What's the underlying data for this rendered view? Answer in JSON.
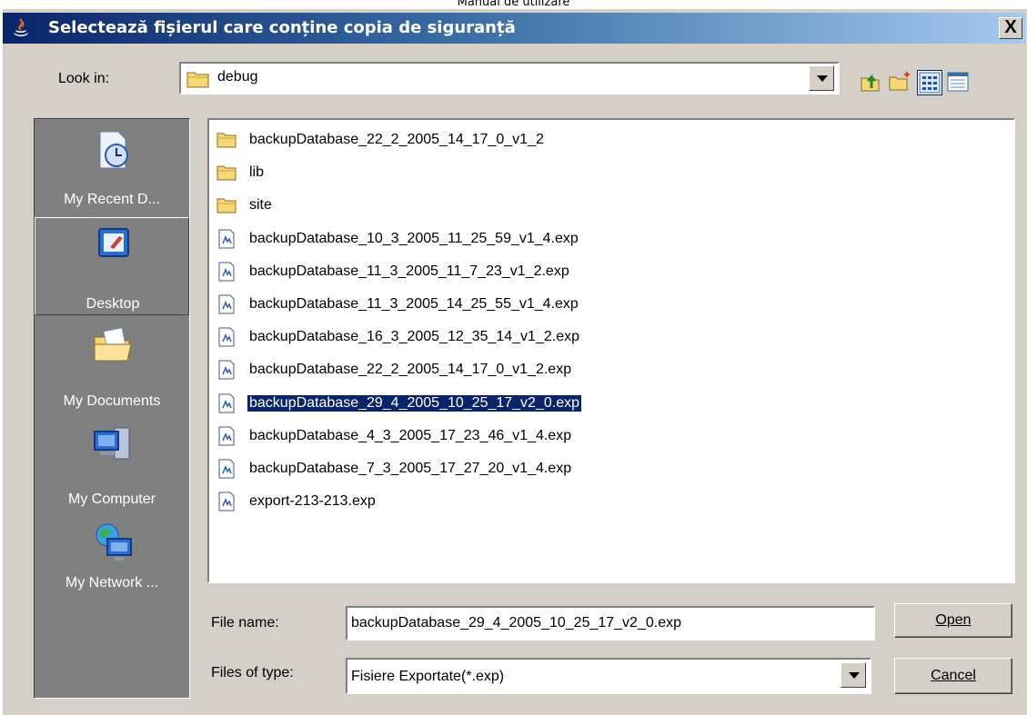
{
  "header": {
    "text": "Manual de utilizare"
  },
  "window": {
    "title": "Selectează fișierul care conține copia de siguranță",
    "close_label": "X"
  },
  "lookin": {
    "label": "Look in:",
    "value": "debug"
  },
  "places": [
    {
      "label": "My Recent D...",
      "icon": "recent-documents-icon"
    },
    {
      "label": "Desktop",
      "icon": "desktop-icon"
    },
    {
      "label": "My Documents",
      "icon": "my-documents-icon"
    },
    {
      "label": "My Computer",
      "icon": "my-computer-icon"
    },
    {
      "label": "My Network ...",
      "icon": "my-network-icon"
    }
  ],
  "files": [
    {
      "name": "backupDatabase_22_2_2005_14_17_0_v1_2",
      "kind": "folder"
    },
    {
      "name": "lib",
      "kind": "folder"
    },
    {
      "name": "site",
      "kind": "folder"
    },
    {
      "name": "backupDatabase_10_3_2005_11_25_59_v1_4.exp",
      "kind": "file"
    },
    {
      "name": "backupDatabase_11_3_2005_11_7_23_v1_2.exp",
      "kind": "file"
    },
    {
      "name": "backupDatabase_11_3_2005_14_25_55_v1_4.exp",
      "kind": "file"
    },
    {
      "name": "backupDatabase_16_3_2005_12_35_14_v1_2.exp",
      "kind": "file"
    },
    {
      "name": "backupDatabase_22_2_2005_14_17_0_v1_2.exp",
      "kind": "file"
    },
    {
      "name": "backupDatabase_29_4_2005_10_25_17_v2_0.exp",
      "kind": "file",
      "selected": true
    },
    {
      "name": "backupDatabase_4_3_2005_17_23_46_v1_4.exp",
      "kind": "file"
    },
    {
      "name": "backupDatabase_7_3_2005_17_27_20_v1_4.exp",
      "kind": "file"
    },
    {
      "name": "export-213-213.exp",
      "kind": "file"
    }
  ],
  "filename": {
    "label": "File name:",
    "value": "backupDatabase_29_4_2005_10_25_17_v2_0.exp"
  },
  "filetype": {
    "label": "Files of type:",
    "value": "Fisiere Exportate(*.exp)"
  },
  "buttons": {
    "open": "Open",
    "cancel": "Cancel"
  },
  "colors": {
    "title_start": "#0a246a",
    "title_end": "#a6caf0",
    "dialog_bg": "#d4d0c8",
    "places_bg": "#808080",
    "selection": "#0a246a"
  }
}
